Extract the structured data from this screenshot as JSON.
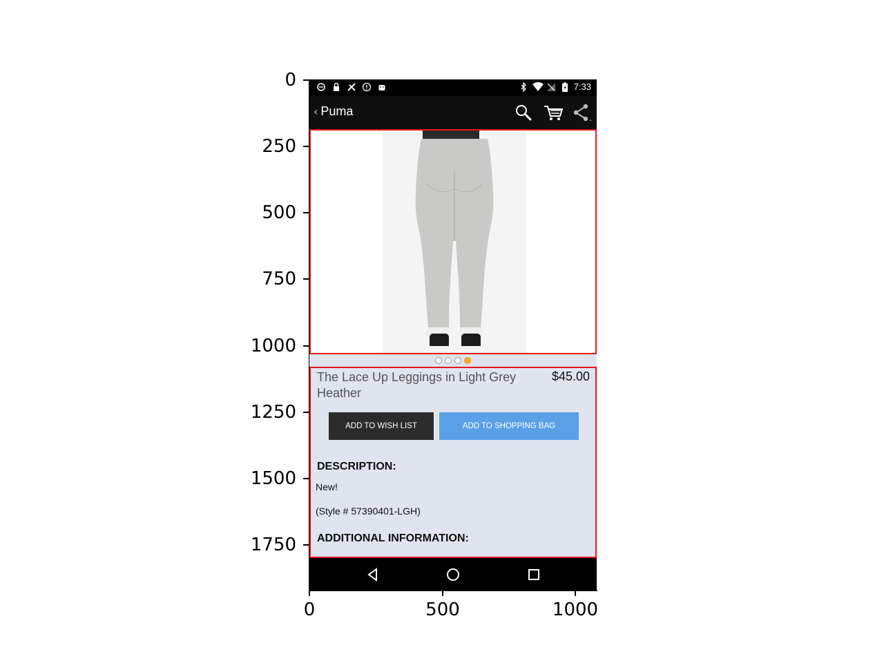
{
  "axes": {
    "y_ticks": [
      "0",
      "250",
      "500",
      "750",
      "1000",
      "1250",
      "1500",
      "1750"
    ],
    "x_ticks": [
      "0",
      "500",
      "1000"
    ]
  },
  "status_bar": {
    "time": "7:33",
    "left_icons": [
      "data-saver-icon",
      "lock-icon",
      "sync-icon",
      "alert-icon",
      "android-icon"
    ],
    "right_icons": [
      "bluetooth-icon",
      "wifi-icon",
      "no-sim-icon",
      "battery-charging-icon"
    ]
  },
  "app_bar": {
    "back_label": "Puma",
    "icons": [
      "search-icon",
      "cart-icon",
      "share-icon"
    ]
  },
  "carousel": {
    "count": 4,
    "active_index": 3,
    "accent_color": "#f5a623"
  },
  "product": {
    "name": "The Lace Up Leggings in Light Grey Heather",
    "price": "$45.00"
  },
  "buttons": {
    "wish_list": "ADD TO WISH LIST",
    "shopping_bag": "ADD TO SHOPPING BAG"
  },
  "description": {
    "heading": "DESCRIPTION:",
    "line1": "New!",
    "line2": "(Style # 57390401-LGH)"
  },
  "additional": {
    "heading": "ADDITIONAL INFORMATION:"
  },
  "nav_bar": {
    "icons": [
      "back-triangle-icon",
      "home-circle-icon",
      "recents-square-icon"
    ]
  },
  "colors": {
    "highlight_border": "#e01b1b",
    "details_bg": "#dfe4ef",
    "wish_button": "#2b2b2b",
    "bag_button": "#5aa0e6"
  }
}
